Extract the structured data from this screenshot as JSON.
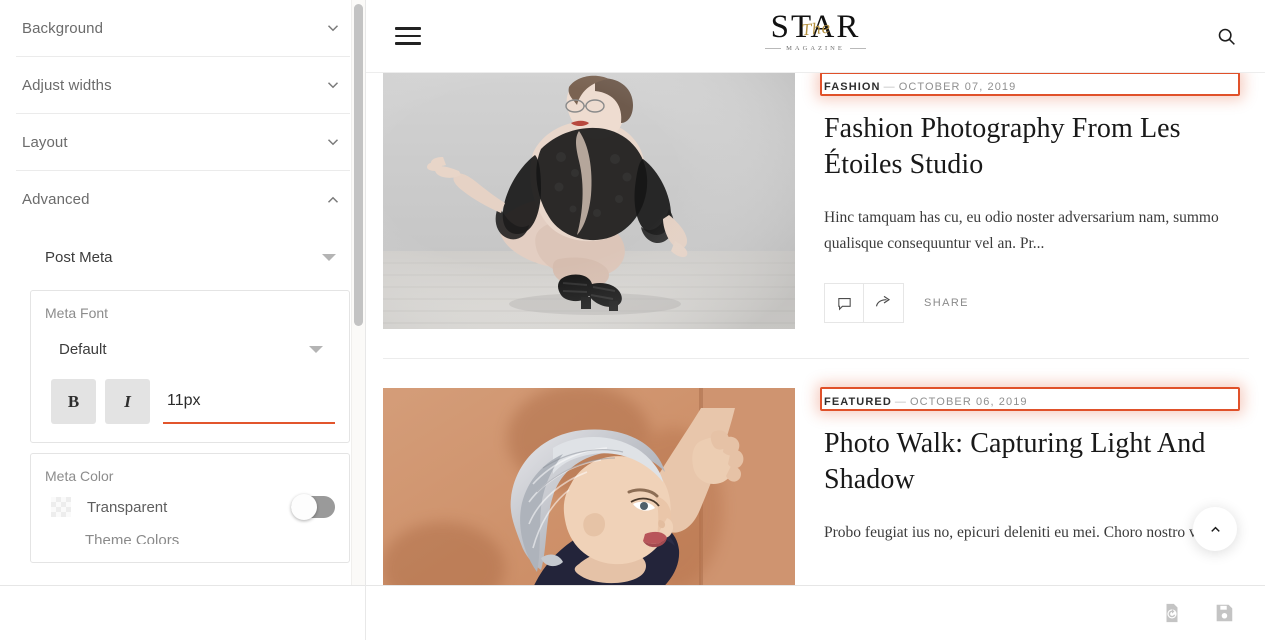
{
  "sidebar": {
    "sections": [
      {
        "label": "Background",
        "icon": "chevron-down-icon",
        "expanded": false
      },
      {
        "label": "Adjust widths",
        "icon": "chevron-down-icon",
        "expanded": false
      },
      {
        "label": "Layout",
        "icon": "chevron-down-icon",
        "expanded": false
      },
      {
        "label": "Advanced",
        "icon": "chevron-up-icon",
        "expanded": true
      }
    ],
    "advanced": {
      "element_select": {
        "value": "Post Meta",
        "icon": "caret-down-icon"
      },
      "meta_font": {
        "title": "Meta Font",
        "family_value": "Default",
        "bold_label": "B",
        "italic_label": "I",
        "size_value": "11px",
        "underline_color": "#e2552c"
      },
      "meta_color": {
        "title": "Meta Color",
        "transparent_label": "Transparent",
        "transparent_on": false,
        "theme_colors_label": "Theme Colors"
      }
    }
  },
  "preview": {
    "header": {
      "menu_icon": "hamburger-icon",
      "search_icon": "search-icon",
      "brand_main": "STAR",
      "brand_script": "The",
      "brand_sub": "MAGAZINE"
    },
    "posts": [
      {
        "category": "FASHION",
        "separator": "—",
        "date": "OCTOBER 07, 2019",
        "title": "Fashion Photography From Les Étoiles Studio",
        "excerpt": "Hinc tamquam has cu, eu odio noster adversarium nam, summo qualisque consequuntur vel an. Pr...",
        "comment_icon": "comment-icon",
        "share_icon": "share-arrow-icon",
        "share_label": "SHARE",
        "image_alt": "woman crouching in black lace bodysuit on grey studio backdrop"
      },
      {
        "category": "FEATURED",
        "separator": "—",
        "date": "OCTOBER 06, 2019",
        "title": "Photo Walk: Capturing Light And Shadow",
        "excerpt": "Probo feugiat ius no, epicuri deleniti eu mei. Choro nostro vim",
        "image_alt": "woman with silver hair leaning against terracotta wall"
      }
    ],
    "to_top_icon": "chevron-up-icon",
    "footer": {
      "revert_icon": "restore-icon",
      "save_icon": "save-icon"
    }
  },
  "colors": {
    "accent": "#e2552c",
    "selection_outline": "#e0512a",
    "brand_gold": "#b5913f"
  }
}
